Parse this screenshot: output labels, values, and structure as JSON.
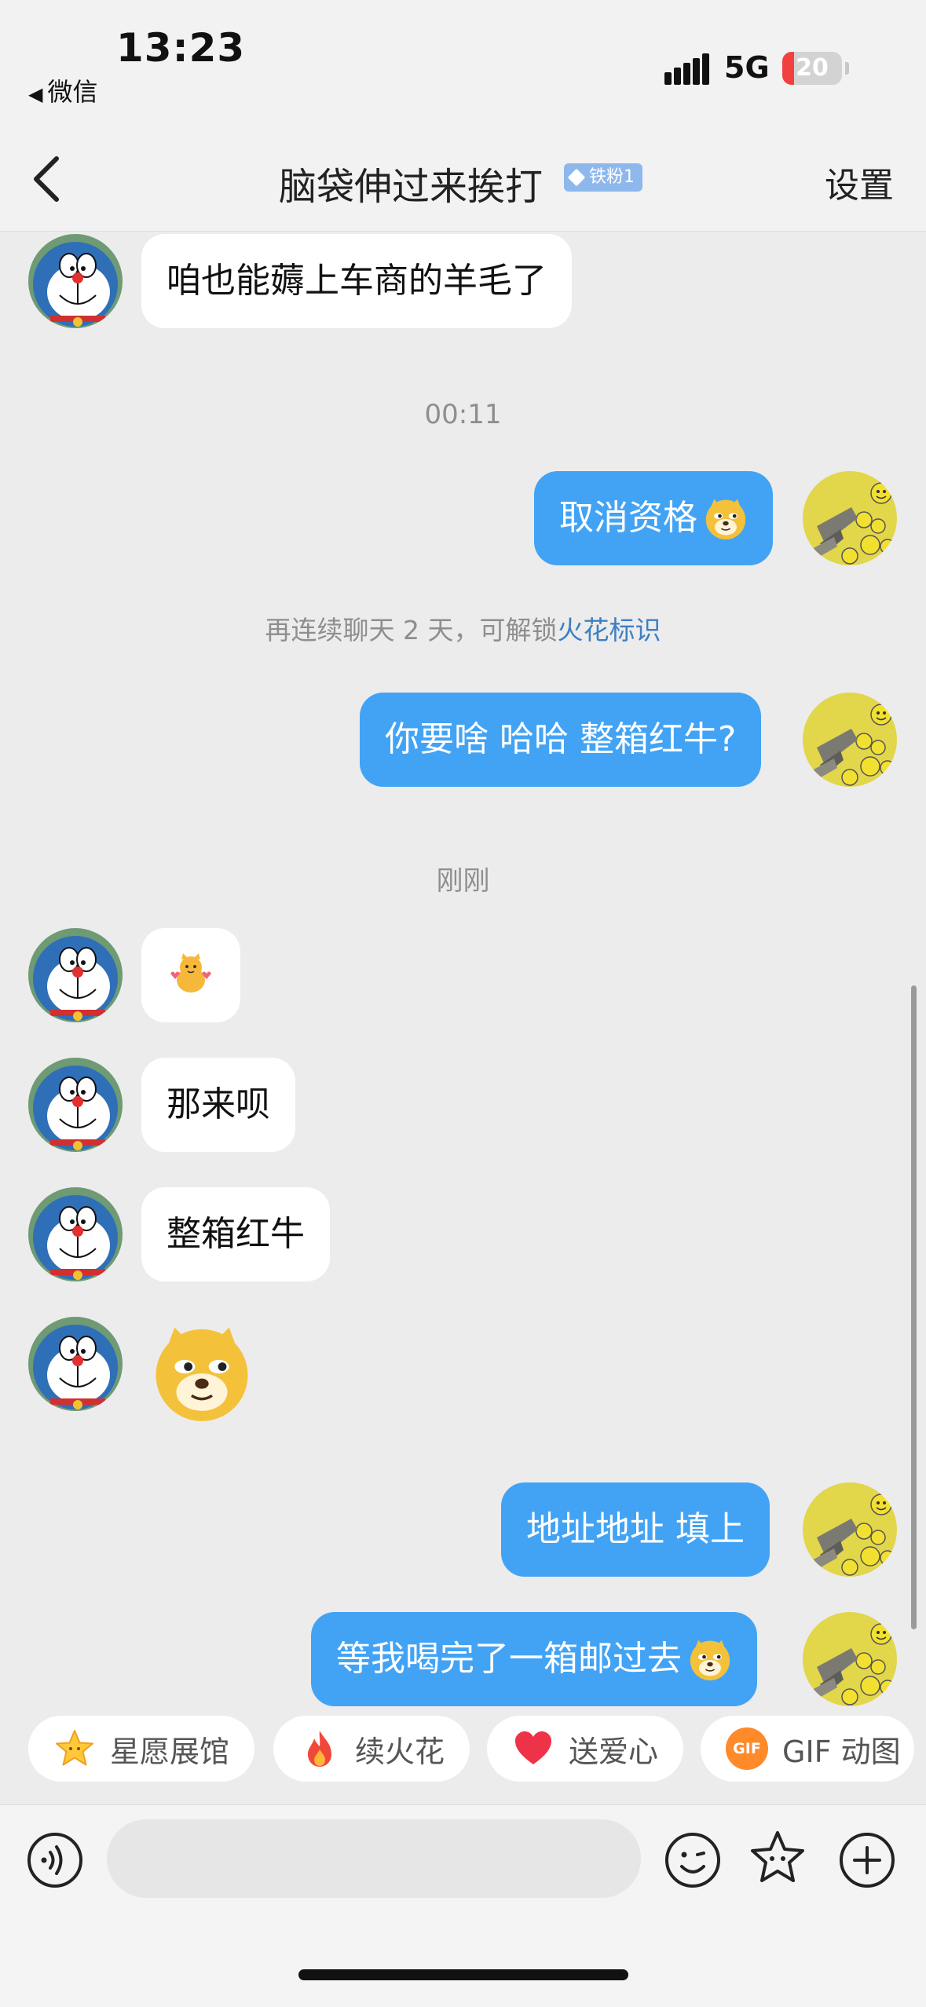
{
  "status_bar": {
    "time": "13:23",
    "back_app": "微信",
    "network": "5G",
    "battery": "20",
    "battery_level": 0.2
  },
  "nav": {
    "title": "脑袋伸过来挨打",
    "badge": "铁粉1",
    "settings": "设置"
  },
  "messages": {
    "m1": "咱也能薅上车商的羊毛了",
    "t1": "00:11",
    "m2": "取消资格",
    "notice_prefix": "再连续聊天 2 天，可解锁",
    "notice_link": "火花标识",
    "m3": "你要啥 哈哈 整箱红牛?",
    "t2": "刚刚",
    "m5": "那来呗",
    "m6": "整箱红牛",
    "m8": "地址地址 填上",
    "m9": "等我喝完了一箱邮过去"
  },
  "chips": {
    "c1": "星愿展馆",
    "c2": "续火花",
    "c3": "送爱心",
    "c4_icon_text": "GIF",
    "c4": "GIF 动图"
  },
  "colors": {
    "outgoing_bubble": "#42a3f5",
    "incoming_bubble": "#ffffff",
    "background": "#ececec",
    "link": "#3d7fc5"
  }
}
